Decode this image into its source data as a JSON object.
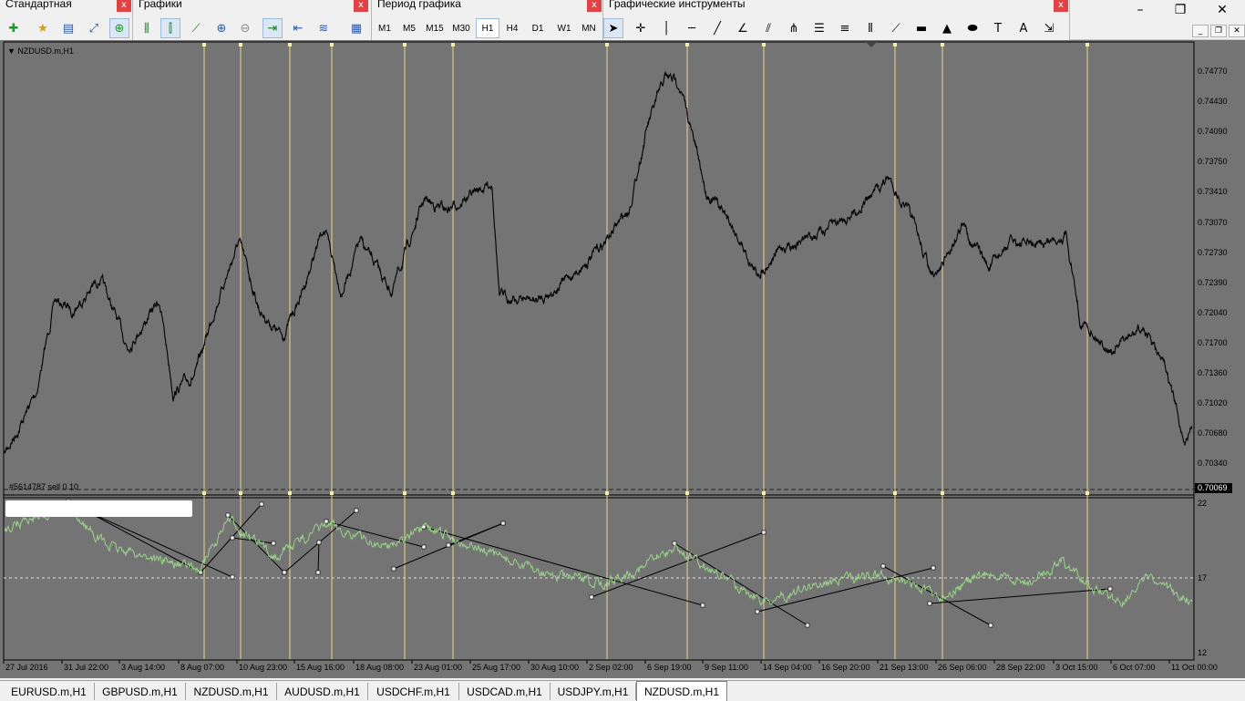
{
  "toolbars": {
    "standard": {
      "title": "Стандартная",
      "close": "x"
    },
    "charts": {
      "title": "Графики",
      "close": "x"
    },
    "period": {
      "title": "Период графика",
      "close": "x",
      "items": [
        "M1",
        "M5",
        "M15",
        "M30",
        "H1",
        "H4",
        "D1",
        "W1",
        "MN"
      ],
      "active": "H1"
    },
    "tools": {
      "title": "Графические инструменты",
      "close": "x"
    }
  },
  "window_controls": {
    "minimize": "–",
    "restore": "❐",
    "close": "✕"
  },
  "mdi_controls": {
    "minimize": "_",
    "restore": "❐",
    "close": "✕"
  },
  "chart": {
    "symbol": "NZDUSD.m,H1",
    "order_label": "#5614787 sell 0.10",
    "current_price": "0.70069",
    "price_ticks": [
      "0.74770",
      "0.74430",
      "0.74090",
      "0.73750",
      "0.73410",
      "0.73070",
      "0.72730",
      "0.72390",
      "0.72040",
      "0.71700",
      "0.71360",
      "0.71020",
      "0.70680",
      "0.70340"
    ],
    "indicator_ticks": [
      "22",
      "17",
      "12"
    ],
    "time_ticks": [
      "27 Jul 2016",
      "31 Jul 22:00",
      "3 Aug 14:00",
      "8 Aug 07:00",
      "10 Aug 23:00",
      "15 Aug 16:00",
      "18 Aug 08:00",
      "23 Aug 01:00",
      "25 Aug 17:00",
      "30 Aug 10:00",
      "2 Sep 02:00",
      "6 Sep 19:00",
      "9 Sep 11:00",
      "14 Sep 04:00",
      "16 Sep 20:00",
      "21 Sep 13:00",
      "26 Sep 06:00",
      "28 Sep 22:00",
      "3 Oct 15:00",
      "6 Oct 07:00",
      "11 Oct 00:00"
    ],
    "colors": {
      "background": "#747474",
      "price_line": "#000000",
      "indicator_line": "#9ad48a",
      "vertical_lines": "#e6d98a"
    }
  },
  "tabs": [
    "EURUSD.m,H1",
    "GBPUSD.m,H1",
    "NZDUSD.m,H1",
    "AUDUSD.m,H1",
    "USDCHF.m,H1",
    "USDCAD.m,H1",
    "USDJPY.m,H1",
    "NZDUSD.m,H1"
  ],
  "active_tab": "NZDUSD.m,H1"
}
